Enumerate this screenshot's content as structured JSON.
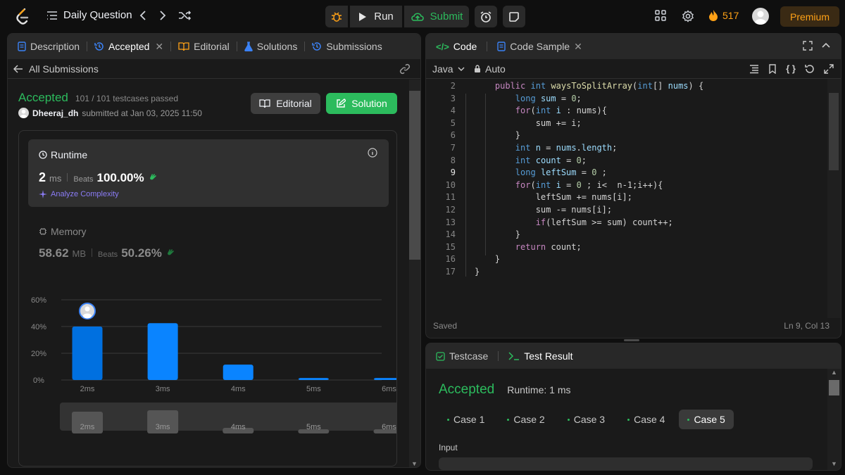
{
  "topbar": {
    "title": "Daily Question",
    "run_label": "Run",
    "submit_label": "Submit",
    "streak": "517",
    "premium_label": "Premium"
  },
  "left": {
    "tabs": [
      "Description",
      "Accepted",
      "Editorial",
      "Solutions",
      "Submissions"
    ],
    "back_label": "All Submissions",
    "status": "Accepted",
    "testcases": "101 / 101 testcases passed",
    "username": "Dheeraj_dh",
    "submitted": "submitted at Jan 03, 2025 11:50",
    "editorial_btn": "Editorial",
    "solution_btn": "Solution",
    "runtime": {
      "label": "Runtime",
      "value": "2",
      "unit": "ms",
      "beats_label": "Beats",
      "beats": "100.00%",
      "analyze": "Analyze Complexity"
    },
    "memory": {
      "label": "Memory",
      "value": "58.62",
      "unit": "MB",
      "beats_label": "Beats",
      "beats": "50.26%"
    }
  },
  "chart_data": {
    "type": "bar",
    "categories": [
      "2ms",
      "3ms",
      "4ms",
      "5ms",
      "6ms"
    ],
    "values": [
      40,
      42.5,
      11.5,
      1.5,
      1.5
    ],
    "yticks": [
      "60%",
      "40%",
      "20%",
      "0%"
    ],
    "ylim": [
      0,
      60
    ],
    "highlight_index": 0,
    "minimap_labels": [
      "2ms",
      "3ms",
      "4ms",
      "5ms",
      "6ms"
    ],
    "bar_color": "#0a84ff",
    "highlight_color": "#0070e0"
  },
  "editor": {
    "tabs": [
      "Code",
      "Code Sample"
    ],
    "language": "Java",
    "mode": "Auto",
    "status": "Saved",
    "cursor": "Ln 9, Col 13",
    "lines": [
      {
        "n": "2",
        "tokens": [
          [
            "    ",
            ""
          ],
          [
            "public",
            "kw"
          ],
          [
            " ",
            ""
          ],
          [
            "int",
            "ty"
          ],
          [
            " ",
            ""
          ],
          [
            "waysToSplitArray",
            "fn"
          ],
          [
            "(",
            "op"
          ],
          [
            "int",
            "ty"
          ],
          [
            "[] ",
            "op"
          ],
          [
            "nums",
            "var"
          ],
          [
            ") {",
            "op"
          ]
        ]
      },
      {
        "n": "3",
        "tokens": [
          [
            "        ",
            ""
          ],
          [
            "long",
            "ty"
          ],
          [
            " ",
            ""
          ],
          [
            "sum",
            "var"
          ],
          [
            " = ",
            "op"
          ],
          [
            "0",
            "num"
          ],
          [
            ";",
            "op"
          ]
        ]
      },
      {
        "n": "4",
        "tokens": [
          [
            "        ",
            ""
          ],
          [
            "for",
            "kw"
          ],
          [
            "(",
            "op"
          ],
          [
            "int",
            "ty"
          ],
          [
            " ",
            ""
          ],
          [
            "i",
            "var"
          ],
          [
            " : ",
            "op"
          ],
          [
            "nums",
            "op"
          ],
          [
            "){",
            "op"
          ]
        ]
      },
      {
        "n": "5",
        "tokens": [
          [
            "            ",
            ""
          ],
          [
            "sum += i;",
            "op"
          ]
        ]
      },
      {
        "n": "6",
        "tokens": [
          [
            "        ",
            ""
          ],
          [
            "}",
            "op"
          ]
        ]
      },
      {
        "n": "7",
        "tokens": [
          [
            "        ",
            ""
          ],
          [
            "int",
            "ty"
          ],
          [
            " ",
            ""
          ],
          [
            "n",
            "var"
          ],
          [
            " = ",
            "op"
          ],
          [
            "nums",
            "var"
          ],
          [
            ".",
            "op"
          ],
          [
            "length",
            "var"
          ],
          [
            ";",
            "op"
          ]
        ]
      },
      {
        "n": "8",
        "tokens": [
          [
            "        ",
            ""
          ],
          [
            "int",
            "ty"
          ],
          [
            " ",
            ""
          ],
          [
            "count",
            "var"
          ],
          [
            " = ",
            "op"
          ],
          [
            "0",
            "num"
          ],
          [
            ";",
            "op"
          ]
        ]
      },
      {
        "n": "9",
        "tokens": [
          [
            "        ",
            ""
          ],
          [
            "long",
            "ty"
          ],
          [
            " ",
            ""
          ],
          [
            "leftSum",
            "var"
          ],
          [
            " = ",
            "op"
          ],
          [
            "0",
            "num"
          ],
          [
            " ;",
            "op"
          ]
        ]
      },
      {
        "n": "10",
        "tokens": [
          [
            "        ",
            ""
          ],
          [
            "for",
            "kw"
          ],
          [
            "(",
            "op"
          ],
          [
            "int",
            "ty"
          ],
          [
            " ",
            ""
          ],
          [
            "i",
            "var"
          ],
          [
            " = ",
            "op"
          ],
          [
            "0",
            "num"
          ],
          [
            " ; i<  n-1;i++){",
            "op"
          ]
        ]
      },
      {
        "n": "11",
        "tokens": [
          [
            "            ",
            ""
          ],
          [
            "leftSum += nums[i];",
            "op"
          ]
        ]
      },
      {
        "n": "12",
        "tokens": [
          [
            "            ",
            ""
          ],
          [
            "sum -= nums[i];",
            "op"
          ]
        ]
      },
      {
        "n": "13",
        "tokens": [
          [
            "            ",
            ""
          ],
          [
            "if",
            "kw"
          ],
          [
            "(leftSum >= sum) count++;",
            "op"
          ]
        ]
      },
      {
        "n": "14",
        "tokens": [
          [
            "        ",
            ""
          ],
          [
            "}",
            "op"
          ]
        ]
      },
      {
        "n": "15",
        "tokens": [
          [
            "        ",
            ""
          ],
          [
            "return",
            "kw"
          ],
          [
            " count;",
            "op"
          ]
        ]
      },
      {
        "n": "16",
        "tokens": [
          [
            "    ",
            ""
          ],
          [
            "}",
            "op"
          ]
        ]
      },
      {
        "n": "17",
        "tokens": [
          [
            "}",
            "op"
          ]
        ]
      }
    ]
  },
  "result": {
    "tabs": [
      "Testcase",
      "Test Result"
    ],
    "status": "Accepted",
    "runtime": "Runtime: 1 ms",
    "cases": [
      "Case 1",
      "Case 2",
      "Case 3",
      "Case 4",
      "Case 5"
    ],
    "active_case": 4,
    "input_label": "Input"
  },
  "colors": {
    "accent_green": "#2cbb5d",
    "accent_orange": "#ffa116",
    "accent_blue": "#0a84ff",
    "panel": "#1a1a1a"
  }
}
